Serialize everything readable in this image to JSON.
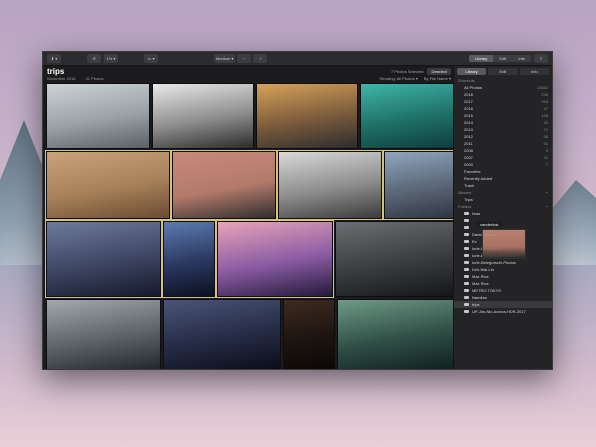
{
  "toolbar": {
    "zoom_value": "1%",
    "view_mode": "Medium",
    "zoom_minus": "−",
    "zoom_plus": "+"
  },
  "library": {
    "title": "trips",
    "date": "November 2018",
    "count": "31 Photos",
    "selected_text": "7 Photos Selected",
    "deselect_label": "Deselect",
    "showing_label": "Showing:",
    "showing_value": "All Photos",
    "sort_value": "By File Name"
  },
  "sidebar": {
    "tabs": [
      "Library",
      "Edit",
      "Info"
    ],
    "shortcuts_header": "Shortcuts",
    "shortcuts": [
      {
        "label": "All Photos",
        "count": "13542"
      },
      {
        "label": "2018",
        "count": "235"
      },
      {
        "label": "2017",
        "count": "318"
      },
      {
        "label": "2016",
        "count": "47"
      },
      {
        "label": "2015",
        "count": "128"
      },
      {
        "label": "2014",
        "count": "43"
      },
      {
        "label": "2013",
        "count": "71"
      },
      {
        "label": "2012",
        "count": "35"
      },
      {
        "label": "2011",
        "count": "91"
      },
      {
        "label": "2008",
        "count": "9"
      },
      {
        "label": "2007",
        "count": "11"
      },
      {
        "label": "2000",
        "count": "7"
      },
      {
        "label": "Favorites",
        "count": ""
      },
      {
        "label": "Recently Added",
        "count": ""
      },
      {
        "label": "Trash",
        "count": ""
      }
    ],
    "albums_header": "Albums",
    "albums": [
      {
        "label": "Trips",
        "count": ""
      }
    ],
    "folders_header": "Folders",
    "drag_label": "vanderlust",
    "folders": [
      {
        "label": "Iwas",
        "count": ""
      },
      {
        "label": "",
        "count": ""
      },
      {
        "label": "",
        "count": ""
      },
      {
        "label": "Daniel Komar",
        "count": ""
      },
      {
        "label": "Ex",
        "count": ""
      },
      {
        "label": "Iurie-Belegurschi",
        "count": ""
      },
      {
        "label": "Iurie-Belegurschi Brackets",
        "count": ""
      },
      {
        "label": "Iurie-Belegurschi-Photos",
        "count": ""
      },
      {
        "label": "Keh-Wai-Lin",
        "count": ""
      },
      {
        "label": "Max Rive",
        "count": ""
      },
      {
        "label": "Max Rive",
        "count": ""
      },
      {
        "label": "METRO TOKYO",
        "count": ""
      },
      {
        "label": "Namibia",
        "count": ""
      },
      {
        "label": "trips",
        "count": ""
      },
      {
        "label": "UP-Jim-Nix-Aurora-HDR-2017",
        "count": ""
      }
    ]
  },
  "photos": [
    {
      "name": "photo-snowy-island",
      "colors": [
        "#cfd3d7",
        "#9aa0a6",
        "#5b6066"
      ],
      "selected": false
    },
    {
      "name": "photo-skater-ramp",
      "colors": [
        "#e8e8e8",
        "#8d8d8d",
        "#2b2b2b"
      ],
      "selected": false
    },
    {
      "name": "photo-mountain-road",
      "colors": [
        "#d8a25a",
        "#7a5b3b",
        "#2c2c30"
      ],
      "selected": false
    },
    {
      "name": "photo-aerial-forest",
      "colors": [
        "#3fb5a9",
        "#1e6f66",
        "#0d3b3a"
      ],
      "selected": false
    },
    {
      "name": "photo-dunes",
      "colors": [
        "#c9a47a",
        "#a68058",
        "#6b4b33"
      ],
      "selected": true
    },
    {
      "name": "photo-sunset-plane",
      "colors": [
        "#c88a7a",
        "#b37a6a",
        "#2e2e2e"
      ],
      "selected": true
    },
    {
      "name": "photo-person-smoke",
      "colors": [
        "#d9d9d9",
        "#8c8c8c",
        "#3a3a3a"
      ],
      "selected": true
    },
    {
      "name": "photo-nyc-street",
      "colors": [
        "#8fa6bf",
        "#5b6676",
        "#2f3542"
      ],
      "selected": true
    },
    {
      "name": "photo-shanghai-skyline",
      "colors": [
        "#6f7a9a",
        "#3d4563",
        "#15192a"
      ],
      "selected": true
    },
    {
      "name": "photo-light-beams",
      "colors": [
        "#5b7bb0",
        "#2a3760",
        "#0b0f20"
      ],
      "selected": true
    },
    {
      "name": "photo-light-trails",
      "colors": [
        "#e7a4b8",
        "#8a5aa3",
        "#231a3a"
      ],
      "selected": true
    },
    {
      "name": "photo-graffiti-moto",
      "colors": [
        "#6b6f73",
        "#3a3c3e",
        "#151617"
      ],
      "selected": false
    },
    {
      "name": "photo-highway",
      "colors": [
        "#a3a8ae",
        "#5c6268",
        "#22262a"
      ],
      "selected": false
    },
    {
      "name": "photo-milky-way",
      "colors": [
        "#4a5478",
        "#252b45",
        "#0a0c18"
      ],
      "selected": false
    },
    {
      "name": "photo-campfire",
      "colors": [
        "#3d2a20",
        "#1d1410",
        "#0a0706"
      ],
      "selected": false
    },
    {
      "name": "photo-tall-trees",
      "colors": [
        "#6f9a87",
        "#2f4e45",
        "#10201c"
      ],
      "selected": false
    }
  ]
}
